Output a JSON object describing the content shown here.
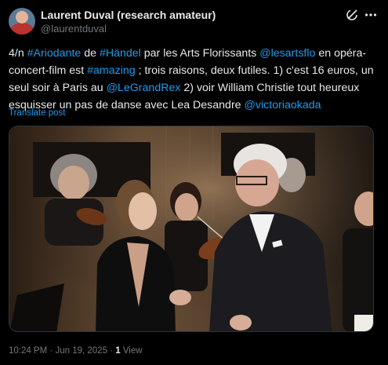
{
  "author": {
    "display_name": "Laurent Duval (research amateur)",
    "handle": "@laurentduval"
  },
  "header_icons": [
    "grok-icon",
    "more-options-icon"
  ],
  "post": {
    "segments": [
      {
        "t": "4/n ",
        "link": false
      },
      {
        "t": "#Ariodante",
        "link": true
      },
      {
        "t": " de ",
        "link": false
      },
      {
        "t": "#Händel",
        "link": true
      },
      {
        "t": " par les Arts Florissants ",
        "link": false
      },
      {
        "t": "@lesartsflo",
        "link": true
      },
      {
        "t": " en opéra-concert-film est ",
        "link": false
      },
      {
        "t": "#amazing",
        "link": true
      },
      {
        "t": " ; trois raisons, deux futiles. 1) c'est 16 euros, un seul soir à Paris au ",
        "link": false
      },
      {
        "t": "@LeGrandRex",
        "link": true
      },
      {
        "t": " 2) voir William Christie tout heureux esquisser un pas de danse avec Lea Desandre ",
        "link": false
      },
      {
        "t": "@victoriaokada",
        "link": true
      }
    ],
    "translate_label": "Translate post"
  },
  "footer": {
    "time": "10:24 PM",
    "sep1": " · ",
    "date": "Jun 19, 2025",
    "sep2": " · ",
    "views_count": "1",
    "views_label": " View"
  },
  "colors": {
    "link": "#1d9bf0",
    "text": "#e7e9ea",
    "muted": "#71767b",
    "background": "#000000"
  }
}
